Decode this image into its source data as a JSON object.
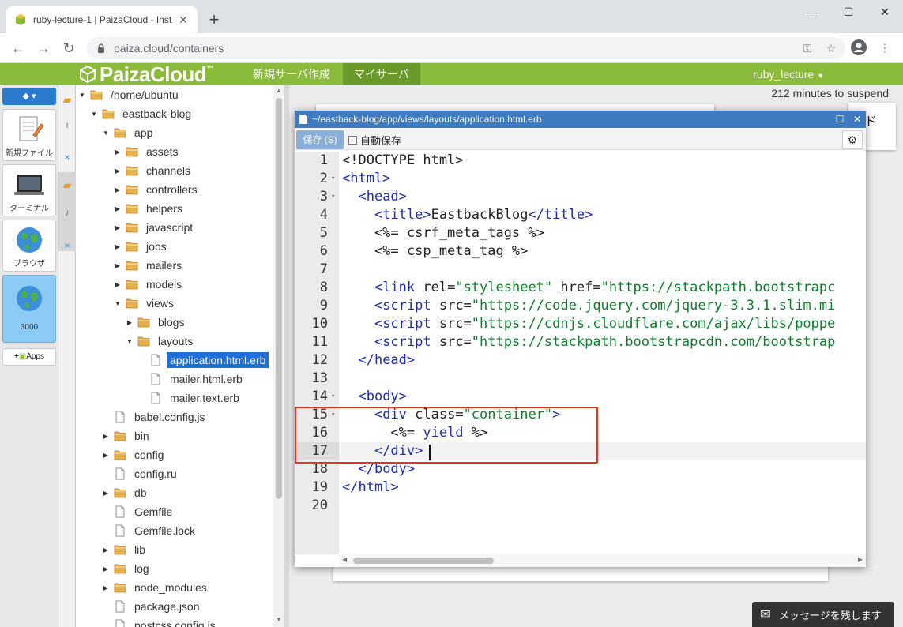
{
  "browser": {
    "tab_title": "ruby-lecture-1 | PaizaCloud - Inst",
    "url": "paiza.cloud/containers"
  },
  "header": {
    "logo": "PaizaCloud",
    "logo_tm": "™",
    "nav": [
      "新規サーバ作成",
      "マイサーバ"
    ],
    "user": "ruby_lecture"
  },
  "dock": {
    "items": [
      {
        "label": "新規ファイル",
        "icon": "new-file-icon"
      },
      {
        "label": "ターミナル",
        "icon": "terminal-icon"
      },
      {
        "label": "ブラウザ",
        "icon": "globe-icon"
      },
      {
        "label": "3000",
        "icon": "globe-icon"
      }
    ],
    "apps_label": "Apps"
  },
  "file_tree": [
    {
      "label": "/home/ubuntu",
      "depth": 0,
      "type": "folder",
      "arrow": "down"
    },
    {
      "label": "eastback-blog",
      "depth": 1,
      "type": "folder",
      "arrow": "down"
    },
    {
      "label": "app",
      "depth": 2,
      "type": "folder",
      "arrow": "down"
    },
    {
      "label": "assets",
      "depth": 3,
      "type": "folder",
      "arrow": "right"
    },
    {
      "label": "channels",
      "depth": 3,
      "type": "folder",
      "arrow": "right"
    },
    {
      "label": "controllers",
      "depth": 3,
      "type": "folder",
      "arrow": "right"
    },
    {
      "label": "helpers",
      "depth": 3,
      "type": "folder",
      "arrow": "right"
    },
    {
      "label": "javascript",
      "depth": 3,
      "type": "folder",
      "arrow": "right"
    },
    {
      "label": "jobs",
      "depth": 3,
      "type": "folder",
      "arrow": "right"
    },
    {
      "label": "mailers",
      "depth": 3,
      "type": "folder",
      "arrow": "right"
    },
    {
      "label": "models",
      "depth": 3,
      "type": "folder",
      "arrow": "right"
    },
    {
      "label": "views",
      "depth": 3,
      "type": "folder",
      "arrow": "down"
    },
    {
      "label": "blogs",
      "depth": 4,
      "type": "folder",
      "arrow": "right"
    },
    {
      "label": "layouts",
      "depth": 4,
      "type": "folder",
      "arrow": "down"
    },
    {
      "label": "application.html.erb",
      "depth": 5,
      "type": "file",
      "selected": true
    },
    {
      "label": "mailer.html.erb",
      "depth": 5,
      "type": "file"
    },
    {
      "label": "mailer.text.erb",
      "depth": 5,
      "type": "file"
    },
    {
      "label": "babel.config.js",
      "depth": 2,
      "type": "file"
    },
    {
      "label": "bin",
      "depth": 2,
      "type": "folder",
      "arrow": "right"
    },
    {
      "label": "config",
      "depth": 2,
      "type": "folder",
      "arrow": "right"
    },
    {
      "label": "config.ru",
      "depth": 2,
      "type": "file"
    },
    {
      "label": "db",
      "depth": 2,
      "type": "folder",
      "arrow": "right"
    },
    {
      "label": "Gemfile",
      "depth": 2,
      "type": "file"
    },
    {
      "label": "Gemfile.lock",
      "depth": 2,
      "type": "file"
    },
    {
      "label": "lib",
      "depth": 2,
      "type": "folder",
      "arrow": "right"
    },
    {
      "label": "log",
      "depth": 2,
      "type": "folder",
      "arrow": "right"
    },
    {
      "label": "node_modules",
      "depth": 2,
      "type": "folder",
      "arrow": "right"
    },
    {
      "label": "package.json",
      "depth": 2,
      "type": "file"
    },
    {
      "label": "postcss.config.js",
      "depth": 2,
      "type": "file"
    }
  ],
  "workspace": {
    "suspend_text": "212 minutes to suspend",
    "bg_window_fragment": "ド"
  },
  "editor": {
    "path": "~/eastback-blog/app/views/layouts/application.html.erb",
    "save_label": "保存 (S)",
    "autosave_label": "自動保存",
    "lines": [
      {
        "n": "1",
        "tokens": [
          [
            "t",
            "<!DOCTYPE html>"
          ]
        ]
      },
      {
        "n": "2",
        "fold": true,
        "tokens": [
          [
            "g",
            "<html>"
          ]
        ]
      },
      {
        "n": "3",
        "fold": true,
        "tokens": [
          [
            "t",
            "  "
          ],
          [
            "g",
            "<head>"
          ]
        ]
      },
      {
        "n": "4",
        "tokens": [
          [
            "t",
            "    "
          ],
          [
            "g",
            "<title>"
          ],
          [
            "t",
            "EastbackBlog"
          ],
          [
            "g",
            "</title>"
          ]
        ]
      },
      {
        "n": "5",
        "tokens": [
          [
            "t",
            "    <%= csrf_meta_tags %>"
          ]
        ]
      },
      {
        "n": "6",
        "tokens": [
          [
            "t",
            "    <%= csp_meta_tag %>"
          ]
        ]
      },
      {
        "n": "7",
        "tokens": []
      },
      {
        "n": "8",
        "tokens": [
          [
            "t",
            "    "
          ],
          [
            "g",
            "<link"
          ],
          [
            "t",
            " rel="
          ],
          [
            "s",
            "\"stylesheet\""
          ],
          [
            "t",
            " href="
          ],
          [
            "s",
            "\"https://stackpath.bootstrapc"
          ]
        ]
      },
      {
        "n": "9",
        "tokens": [
          [
            "t",
            "    "
          ],
          [
            "g",
            "<script"
          ],
          [
            "t",
            " src="
          ],
          [
            "s",
            "\"https://code.jquery.com/jquery-3.3.1.slim.mi"
          ]
        ]
      },
      {
        "n": "10",
        "tokens": [
          [
            "t",
            "    "
          ],
          [
            "g",
            "<script"
          ],
          [
            "t",
            " src="
          ],
          [
            "s",
            "\"https://cdnjs.cloudflare.com/ajax/libs/poppe"
          ]
        ]
      },
      {
        "n": "11",
        "tokens": [
          [
            "t",
            "    "
          ],
          [
            "g",
            "<script"
          ],
          [
            "t",
            " src="
          ],
          [
            "s",
            "\"https://stackpath.bootstrapcdn.com/bootstrap"
          ]
        ]
      },
      {
        "n": "12",
        "tokens": [
          [
            "t",
            "  "
          ],
          [
            "g",
            "</head>"
          ]
        ]
      },
      {
        "n": "13",
        "tokens": []
      },
      {
        "n": "14",
        "fold": true,
        "tokens": [
          [
            "t",
            "  "
          ],
          [
            "g",
            "<body>"
          ]
        ]
      },
      {
        "n": "15",
        "fold": true,
        "tokens": [
          [
            "t",
            "    "
          ],
          [
            "g",
            "<div"
          ],
          [
            "t",
            " class="
          ],
          [
            "s",
            "\"container\""
          ],
          [
            "g",
            ">"
          ]
        ]
      },
      {
        "n": "16",
        "tokens": [
          [
            "t",
            "      <%= "
          ],
          [
            "k",
            "yield"
          ],
          [
            "t",
            " %>"
          ]
        ]
      },
      {
        "n": "17",
        "active": true,
        "tokens": [
          [
            "t",
            "    "
          ],
          [
            "g",
            "</div>"
          ]
        ]
      },
      {
        "n": "18",
        "tokens": [
          [
            "t",
            "  "
          ],
          [
            "g",
            "</body>"
          ]
        ]
      },
      {
        "n": "19",
        "tokens": [
          [
            "g",
            "</html>"
          ]
        ]
      },
      {
        "n": "20",
        "tokens": []
      }
    ]
  },
  "message_button": "メッセージを残します",
  "colors": {
    "paiza_green": "#8bbb3a",
    "editor_title_blue": "#3e7bc0",
    "tree_selection": "#1e6fd9",
    "highlight_red": "#e8331c"
  }
}
